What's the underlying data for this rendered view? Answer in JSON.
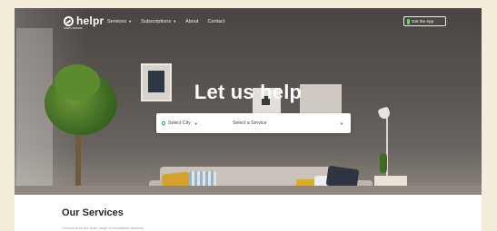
{
  "brand": {
    "name": "helpr",
    "tagline": "kaam aasaan"
  },
  "nav": {
    "links": [
      {
        "label": "Services",
        "has_dropdown": true
      },
      {
        "label": "Subscriptions",
        "has_dropdown": true
      },
      {
        "label": "About",
        "has_dropdown": false
      },
      {
        "label": "Contact",
        "has_dropdown": false
      }
    ],
    "app_button": "Get the App"
  },
  "hero": {
    "headline": "Let us help",
    "search": {
      "city_label": "Select City",
      "service_label": "Select a Service"
    }
  },
  "services": {
    "title": "Our Services",
    "subtitle": "Choose from our wide range of household services"
  },
  "colors": {
    "accent": "#2fae5a",
    "heading": "#1f2430",
    "page_bg": "#f3edd9"
  }
}
